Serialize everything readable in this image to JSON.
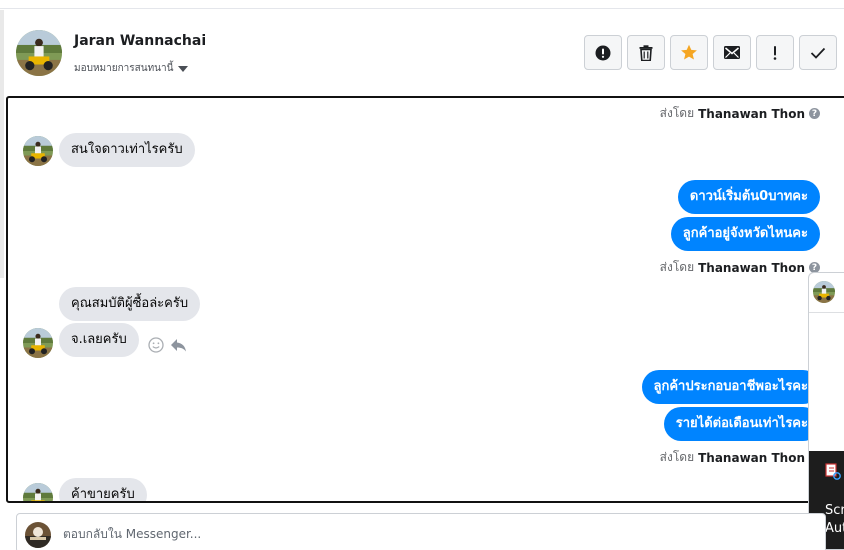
{
  "header": {
    "contact_name": "Jaran Wannachai",
    "assign_label": "มอบหมายการสนทนานี้"
  },
  "toolbar": {
    "buttons": [
      {
        "name": "mark-spam",
        "icon": "exclamation-circle-icon"
      },
      {
        "name": "delete",
        "icon": "trash-icon"
      },
      {
        "name": "star",
        "icon": "star-icon"
      },
      {
        "name": "mark-unread",
        "icon": "envelope-icon"
      },
      {
        "name": "follow-up",
        "icon": "exclamation-icon"
      },
      {
        "name": "mark-done",
        "icon": "check-icon"
      }
    ]
  },
  "thread": {
    "sent_by_prefix": "ส่งโดย",
    "sender_name": "Thanawan Thon",
    "help_mark": "?",
    "messages": [
      {
        "dir": "in",
        "text": "สนใจดาวเท่าไรครับ"
      },
      {
        "dir": "out",
        "text": "ดาวน์เริ่มต้น0บาทคะ"
      },
      {
        "dir": "out",
        "text": "ลูกค้าอยู่จังหวัดไหนคะ"
      },
      {
        "dir": "in",
        "text": "คุณสมบัติผู้ซื้อล่ะครับ"
      },
      {
        "dir": "in",
        "text": "จ.เลยครับ"
      },
      {
        "dir": "out",
        "text": "ลูกค้าประกอบอาชีพอะไรคะ"
      },
      {
        "dir": "out",
        "text": "รายได้ต่อเดือนเท่าไรคะ"
      },
      {
        "dir": "in",
        "text": "ค้าขายครับ"
      }
    ]
  },
  "popup": {
    "line1": "Scr",
    "line2": "Aut"
  },
  "reply": {
    "placeholder": "ตอบกลับใน Messenger..."
  },
  "colors": {
    "outgoing_bubble": "#0084ff",
    "incoming_bubble": "#e4e6eb",
    "star": "#f5a623"
  }
}
